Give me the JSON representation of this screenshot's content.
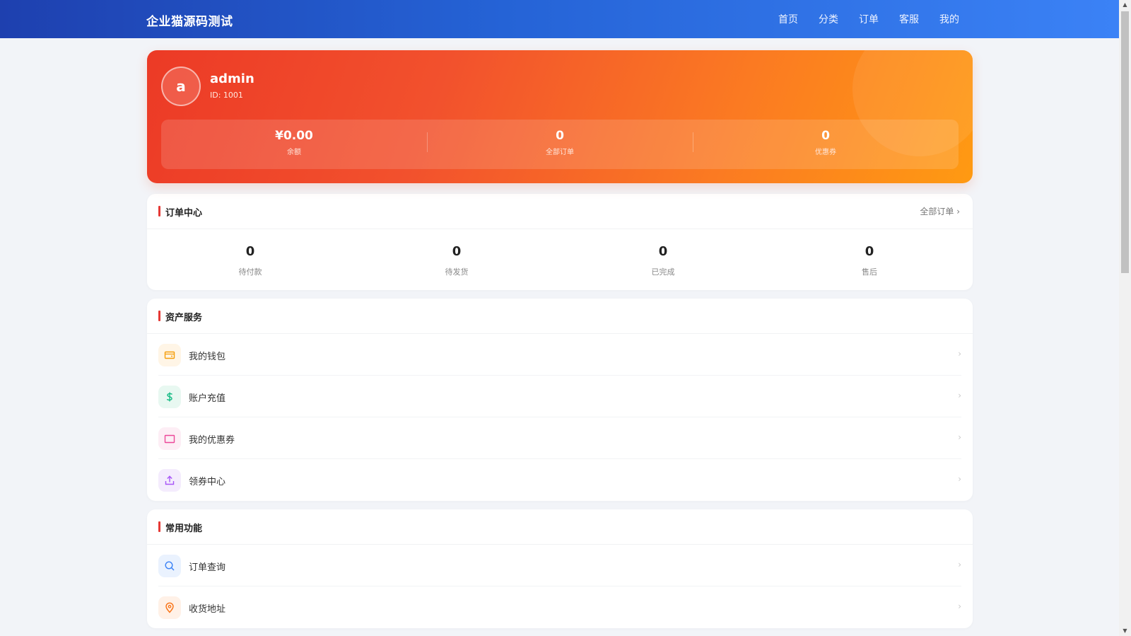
{
  "header": {
    "brand": "企业猫源码测试",
    "nav": [
      "首页",
      "分类",
      "订单",
      "客服",
      "我的"
    ]
  },
  "profile": {
    "avatar_letter": "a",
    "username": "admin",
    "user_id": "ID: 1001",
    "stats": [
      {
        "value": "¥0.00",
        "label": "余额"
      },
      {
        "value": "0",
        "label": "全部订单"
      },
      {
        "value": "0",
        "label": "优惠券"
      }
    ]
  },
  "order_center": {
    "title": "订单中心",
    "link": "全部订单 ›",
    "items": [
      {
        "count": "0",
        "label": "待付款"
      },
      {
        "count": "0",
        "label": "待发货"
      },
      {
        "count": "0",
        "label": "已完成"
      },
      {
        "count": "0",
        "label": "售后"
      }
    ]
  },
  "asset_services": {
    "title": "资产服务",
    "items": [
      {
        "label": "我的钱包",
        "icon": "wallet-icon",
        "color": "#f59e0b",
        "bg": "#fff5e6"
      },
      {
        "label": "账户充值",
        "icon": "dollar-icon",
        "color": "#10b981",
        "bg": "#e8f8f1"
      },
      {
        "label": "我的优惠券",
        "icon": "coupon-icon",
        "color": "#ec4899",
        "bg": "#fdeef5"
      },
      {
        "label": "领券中心",
        "icon": "upload-icon",
        "color": "#a855f7",
        "bg": "#f4ecfd"
      }
    ]
  },
  "common_functions": {
    "title": "常用功能",
    "items": [
      {
        "label": "订单查询",
        "icon": "search-icon",
        "color": "#3b82f6",
        "bg": "#eaf2fe"
      },
      {
        "label": "收货地址",
        "icon": "location-pin-icon",
        "color": "#f97316",
        "bg": "#fff1e7"
      }
    ]
  },
  "arrow": "›"
}
